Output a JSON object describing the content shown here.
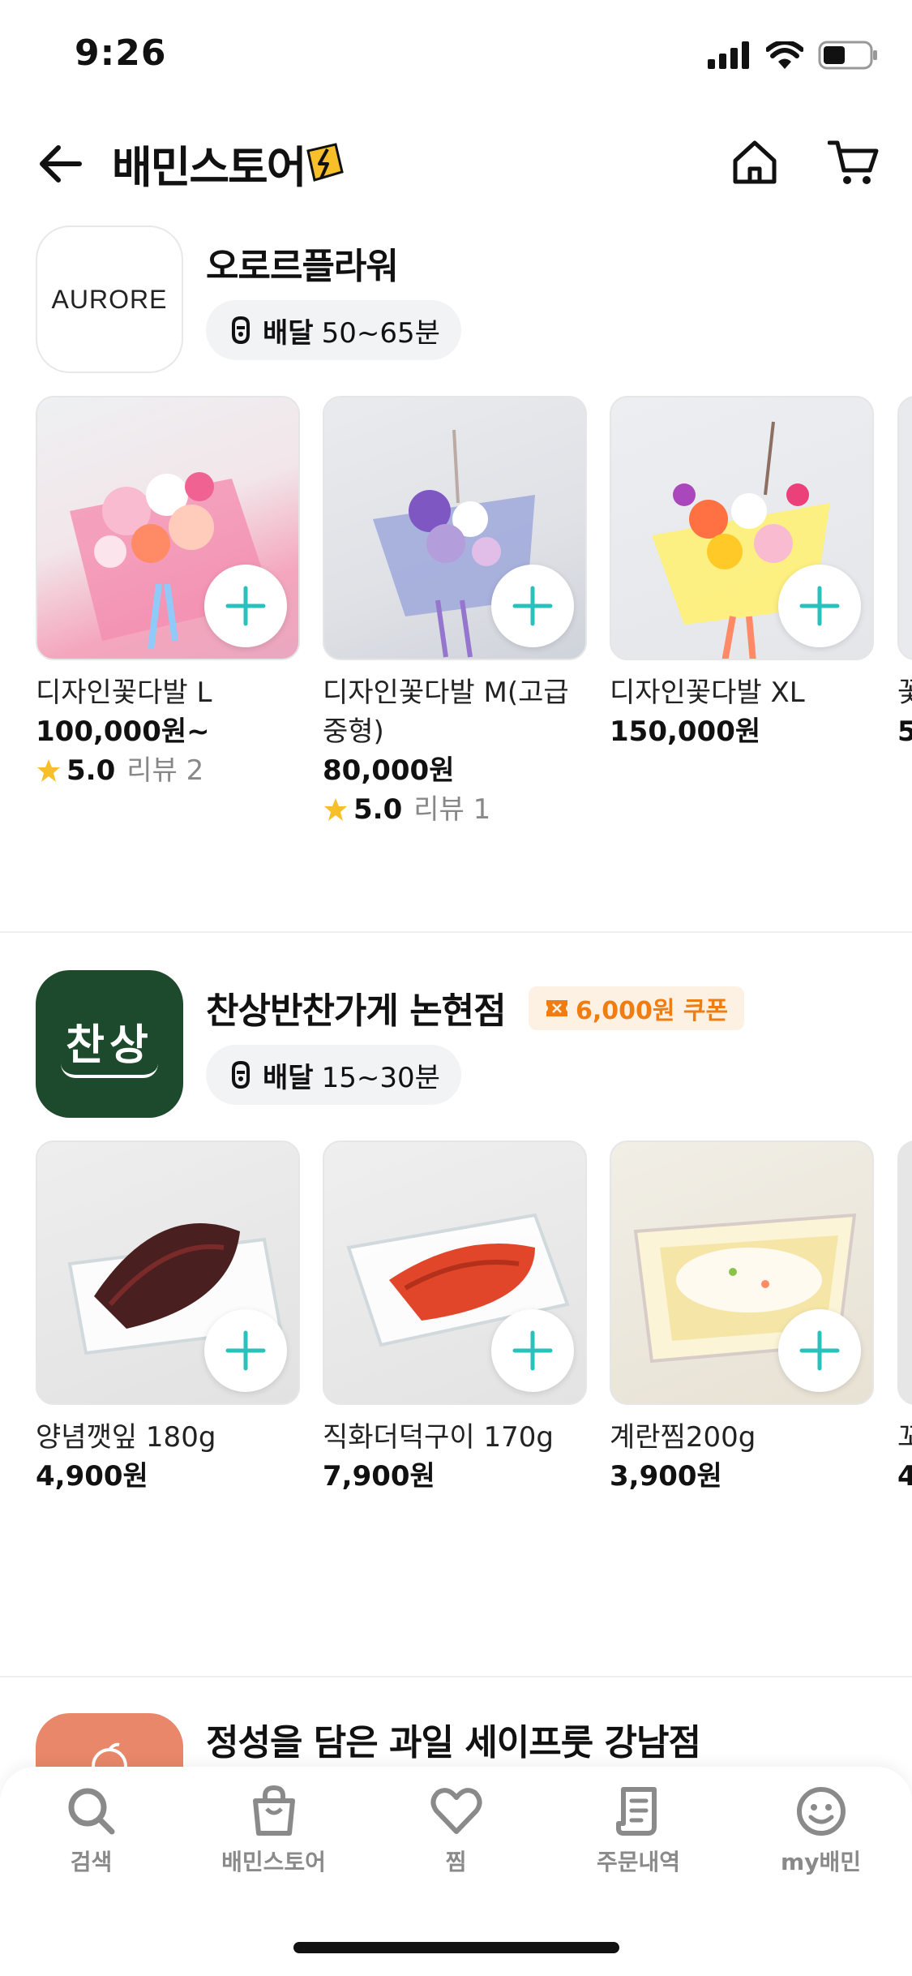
{
  "status_bar": {
    "time": "9:26"
  },
  "header": {
    "brand": "배민스토어"
  },
  "stores": [
    {
      "name": "오로르플라워",
      "logo_text": "AURORE",
      "delivery_label": "배달",
      "delivery_time": "50~65분",
      "products": [
        {
          "name": "디자인꽃다발 L",
          "price": "100,000원~",
          "rating": "5.0",
          "reviews": "리뷰 2"
        },
        {
          "name": "디자인꽃다발 M(고급중형)",
          "price": "80,000원",
          "rating": "5.0",
          "reviews": "리뷰 1"
        },
        {
          "name": "디자인꽃다발 XL",
          "price": "150,000원"
        }
      ],
      "peek_name": "꽃",
      "peek_price": "5"
    },
    {
      "name": "찬상반찬가게 논현점",
      "logo_text": "찬상",
      "coupon": "6,000원 쿠폰",
      "delivery_label": "배달",
      "delivery_time": "15~30분",
      "products": [
        {
          "name": "양념깻잎 180g",
          "price": "4,900원"
        },
        {
          "name": "직화더덕구이 170g",
          "price": "7,900원"
        },
        {
          "name": "계란찜200g",
          "price": "3,900원"
        }
      ],
      "peek_name": "꼬",
      "peek_price": "4"
    },
    {
      "name": "정성을 담은 과일 세이프룻 강남점"
    }
  ],
  "bottom_nav": [
    {
      "label": "검색",
      "icon": "search-icon"
    },
    {
      "label": "배민스토어",
      "icon": "shopping-bag-icon"
    },
    {
      "label": "찜",
      "icon": "heart-icon"
    },
    {
      "label": "주문내역",
      "icon": "receipt-icon"
    },
    {
      "label": "my배민",
      "icon": "smiley-icon"
    }
  ],
  "colors": {
    "accent": "#2ac1bc",
    "coupon": "#ef7d12",
    "star": "#f7c02b"
  }
}
